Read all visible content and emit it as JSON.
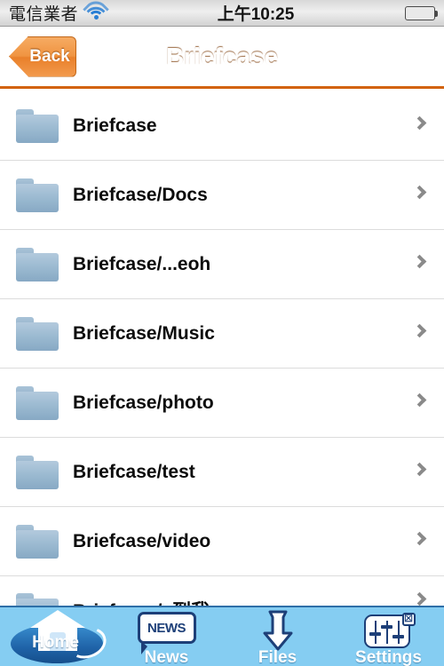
{
  "status_bar": {
    "carrier": "電信業者",
    "wifi_icon": "wifi-icon",
    "time": "上午10:25",
    "battery_icon": "battery-full-icon"
  },
  "nav_bar": {
    "back_label": "Back",
    "title": "Briefcase",
    "background_color": "#ef8b30"
  },
  "list": {
    "rows": [
      {
        "label": "Briefcase",
        "icon": "folder-icon",
        "accessory": "chevron-right-icon"
      },
      {
        "label": "Briefcase/Docs",
        "icon": "folder-icon",
        "accessory": "chevron-right-icon"
      },
      {
        "label": "Briefcase/...eoh",
        "icon": "folder-icon",
        "accessory": "chevron-right-icon"
      },
      {
        "label": "Briefcase/Music",
        "icon": "folder-icon",
        "accessory": "chevron-right-icon"
      },
      {
        "label": "Briefcase/photo",
        "icon": "folder-icon",
        "accessory": "chevron-right-icon"
      },
      {
        "label": "Briefcase/test",
        "icon": "folder-icon",
        "accessory": "chevron-right-icon"
      },
      {
        "label": "Briefcase/video",
        "icon": "folder-icon",
        "accessory": "chevron-right-icon"
      },
      {
        "label": "Briefcase/..到我",
        "icon": "folder-icon",
        "accessory": "chevron-right-icon"
      }
    ]
  },
  "tab_bar": {
    "background_color": "#85cdf2",
    "items": [
      {
        "label": "Home",
        "icon": "house-icon",
        "selected": true
      },
      {
        "label": "News",
        "icon": "news-bubble-icon",
        "bubble_text": "NEWS",
        "selected": false
      },
      {
        "label": "Files",
        "icon": "download-arrow-icon",
        "selected": false
      },
      {
        "label": "Settings",
        "icon": "sliders-icon",
        "badge": "☒",
        "selected": false
      }
    ]
  }
}
